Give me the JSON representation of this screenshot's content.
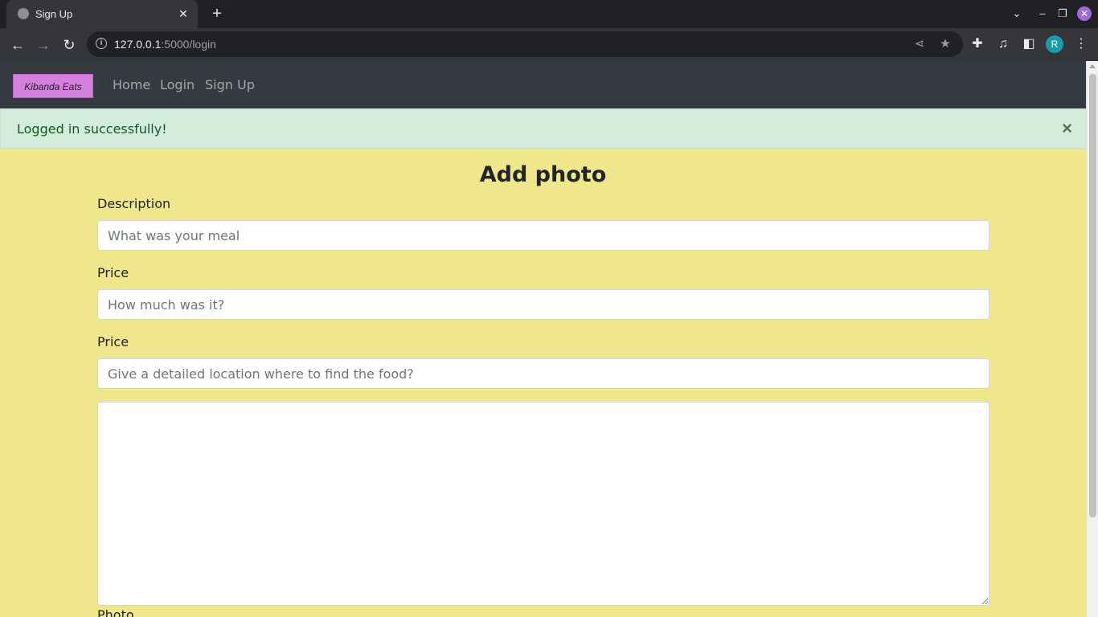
{
  "browser": {
    "tab_title": "Sign Up",
    "url_host": "127.0.0.1",
    "url_rest": ":5000/login",
    "profile_initial": "R"
  },
  "navbar": {
    "brand": "Kibanda Eats",
    "links": [
      "Home",
      "Login",
      "Sign Up"
    ]
  },
  "alert": {
    "message": "Logged in successfully!",
    "close": "×"
  },
  "form": {
    "title": "Add photo",
    "description_label": "Description",
    "description_placeholder": "What was your meal",
    "price_label": "Price",
    "price_placeholder": "How much was it?",
    "location_label": "Price",
    "location_placeholder": "Give a detailed location where to find the food?",
    "photo_label": "Photo"
  },
  "colors": {
    "page_background": "#f0e68c",
    "navbar_background": "#343a40",
    "brand_background": "#d580dd",
    "alert_background": "#d4edda"
  }
}
